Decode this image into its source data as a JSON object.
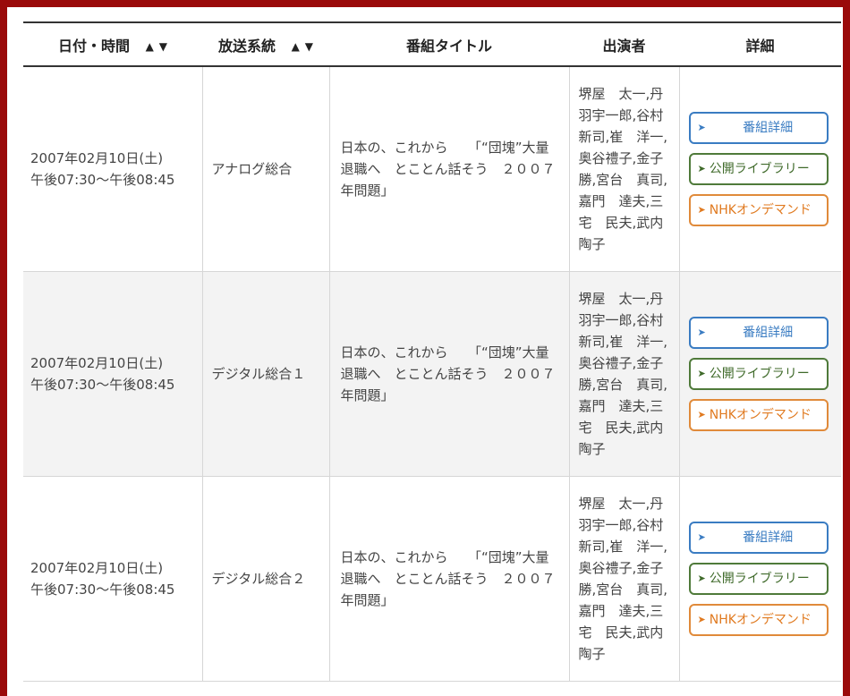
{
  "headers": {
    "datetime": "日付・時間",
    "channel": "放送系統",
    "title": "番組タイトル",
    "cast": "出演者",
    "detail": "詳細",
    "sort_up": "▲",
    "sort_down": "▼"
  },
  "rows": [
    {
      "date": "2007年02月10日(土)",
      "time": "午後07:30～午後08:45",
      "channel": "アナログ総合",
      "title": "日本の、これから　　「“団塊”大量退職へ　とことん話そう　２００７年問題」",
      "cast": "堺屋　太一,丹羽宇一郎,谷村　新司,崔　洋一,奥谷禮子,金子勝,宮台　真司,嘉門　達夫,三宅　民夫,武内　陶子"
    },
    {
      "date": "2007年02月10日(土)",
      "time": "午後07:30～午後08:45",
      "channel": "デジタル総合１",
      "title": "日本の、これから　　「“団塊”大量退職へ　とことん話そう　２００７年問題」",
      "cast": "堺屋　太一,丹羽宇一郎,谷村　新司,崔　洋一,奥谷禮子,金子勝,宮台　真司,嘉門　達夫,三宅　民夫,武内　陶子"
    },
    {
      "date": "2007年02月10日(土)",
      "time": "午後07:30～午後08:45",
      "channel": "デジタル総合２",
      "title": "日本の、これから　　「“団塊”大量退職へ　とことん話そう　２００７年問題」",
      "cast": "堺屋　太一,丹羽宇一郎,谷村　新司,崔　洋一,奥谷禮子,金子勝,宮台　真司,嘉門　達夫,三宅　民夫,武内　陶子"
    }
  ],
  "buttons": {
    "detail": "番組詳細",
    "library": "公開ライブラリー",
    "ondemand": "NHKオンデマンド",
    "arrow": "➤"
  },
  "colors": {
    "frame": "#9a0a0a",
    "detail_button": "#3a7cc2",
    "library_button": "#4f7a3a",
    "ondemand_button": "#e08a3a"
  }
}
